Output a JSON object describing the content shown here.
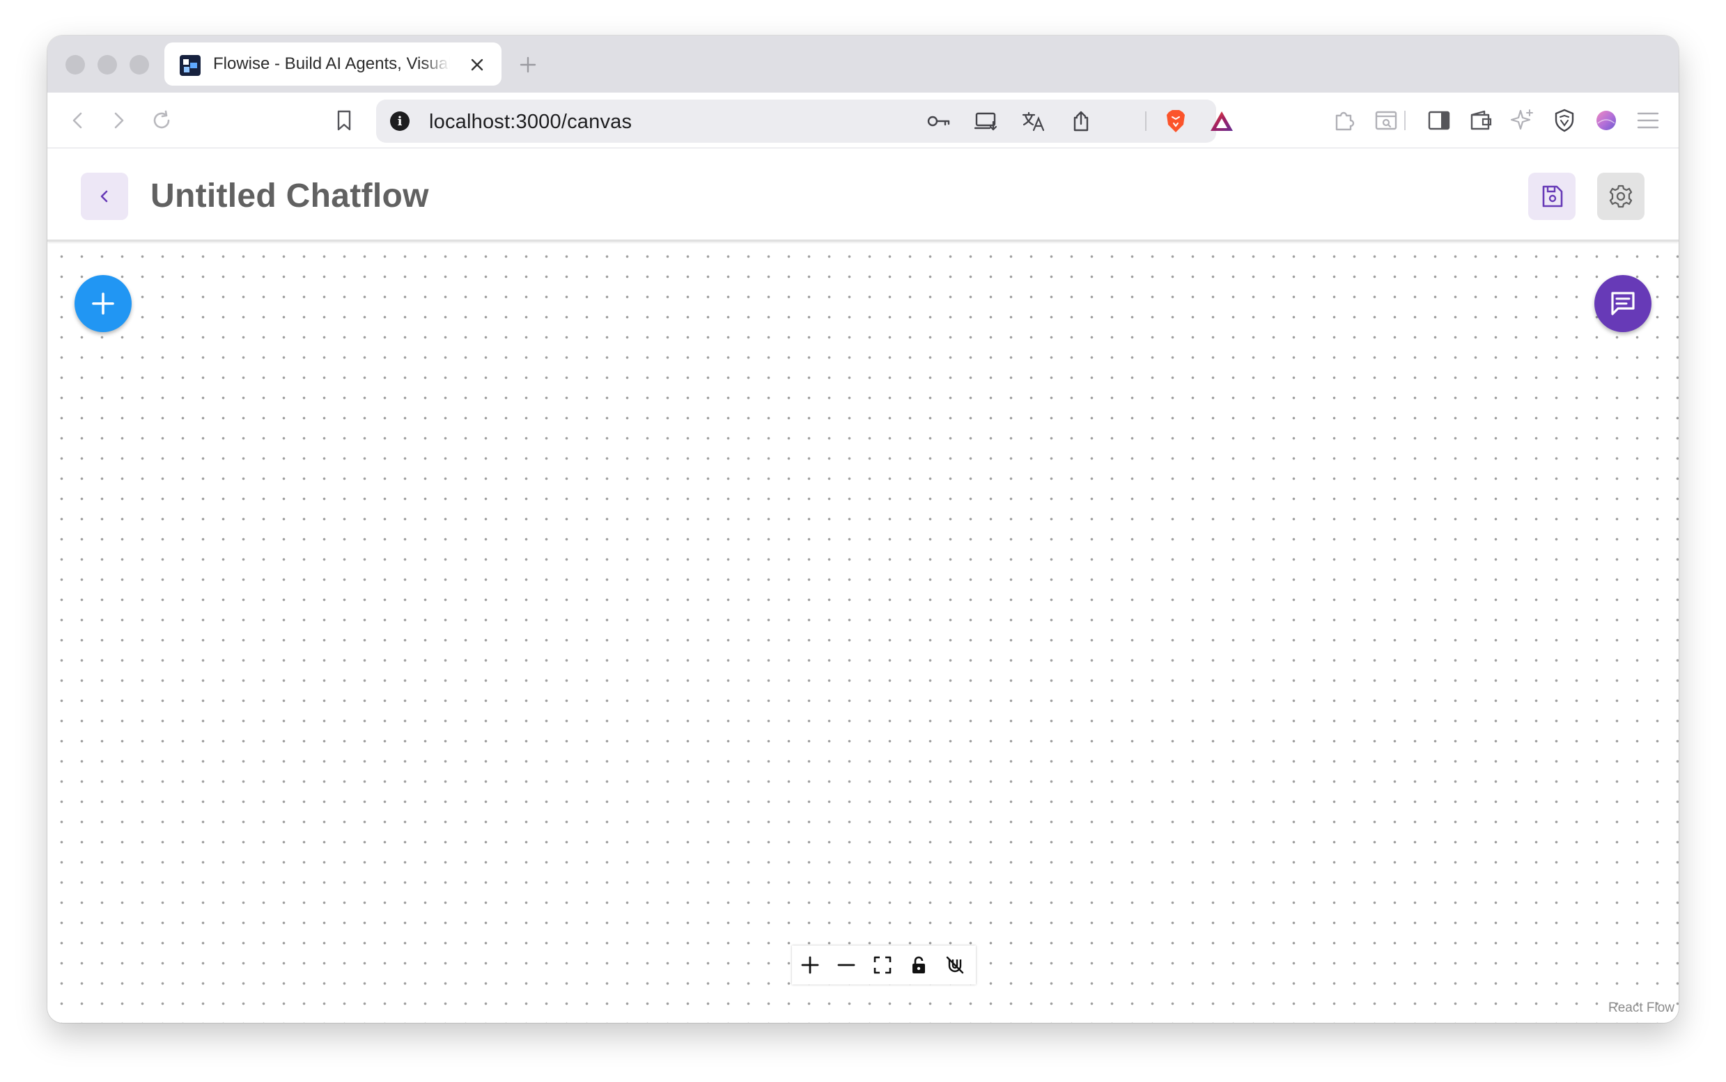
{
  "browser": {
    "tab": {
      "title": "Flowise - Build AI Agents, Visually",
      "favicon": "flowise-logo-icon"
    },
    "address_bar": {
      "url": "localhost:3000/canvas"
    },
    "icons": {
      "nav": [
        "back-arrow-icon",
        "forward-arrow-icon",
        "reload-icon",
        "bookmark-icon"
      ],
      "url_actions": [
        "key-icon",
        "install-app-icon",
        "translate-icon",
        "share-icon",
        "brave-shields-icon",
        "brave-rewards-icon"
      ],
      "extensions": [
        "extensions-puzzle-icon",
        "screenshot-icon",
        "sidebar-icon",
        "wallet-icon",
        "leo-ai-icon",
        "vpn-shield-icon",
        "profile-avatar-icon",
        "menu-icon"
      ]
    }
  },
  "header": {
    "title": "Untitled Chatflow",
    "back_icon": "chevron-left-icon",
    "save_icon": "floppy-disk-icon",
    "settings_icon": "gear-icon"
  },
  "canvas": {
    "add_node_icon": "plus-icon",
    "chat_icon": "chat-bubble-icon",
    "controls": [
      "zoom-in-icon",
      "zoom-out-icon",
      "fit-view-icon",
      "lock-icon",
      "magnet-off-icon"
    ],
    "attribution": "React Flow"
  },
  "colors": {
    "add_fab": "#2196f3",
    "chat_fab": "#673ab7",
    "header_button_bg": "#ede7f6",
    "title_text": "#616161"
  }
}
